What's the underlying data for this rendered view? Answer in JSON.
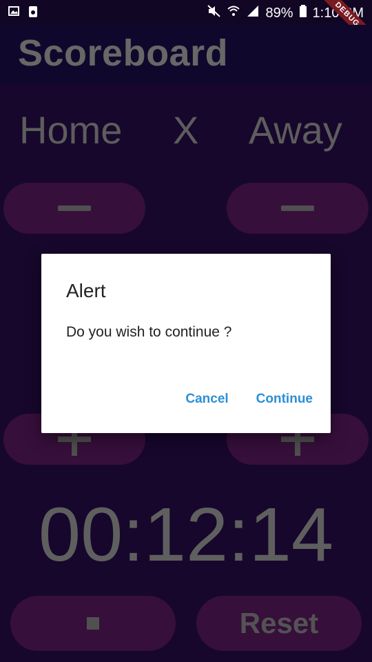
{
  "status_bar": {
    "battery": "89%",
    "time": "1:10 PM",
    "debug_banner": "DEBUG"
  },
  "app_bar": {
    "title": "Scoreboard"
  },
  "teams": {
    "home": "Home",
    "separator": "X",
    "away": "Away"
  },
  "timer": {
    "value": "00:12:14"
  },
  "controls": {
    "reset_label": "Reset"
  },
  "dialog": {
    "title": "Alert",
    "message": "Do you wish to continue ?",
    "cancel_label": "Cancel",
    "continue_label": "Continue"
  },
  "colors": {
    "background": "#1f0a3b",
    "app_bar": "#160b3b",
    "pill": "#4a154f",
    "accent": "#2d8fd5"
  }
}
